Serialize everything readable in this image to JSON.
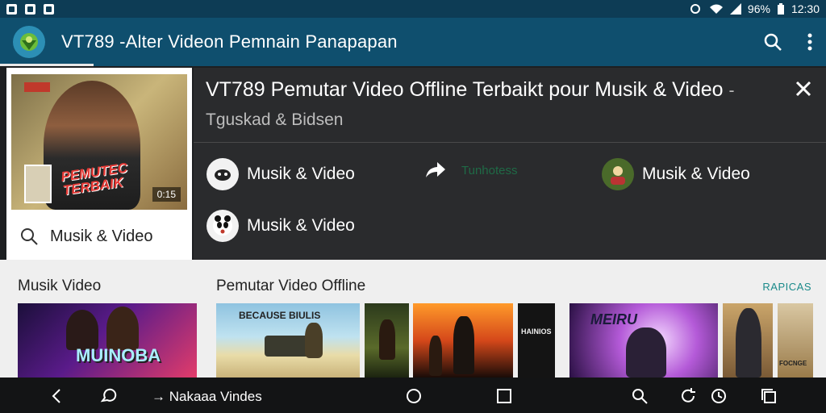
{
  "status": {
    "battery_pct": "96%",
    "time": "12:30"
  },
  "appbar": {
    "title": "VT789 -Alter Videon Pemnain Panapapan"
  },
  "left_card": {
    "overlay_text": "PEMUTEC TERBAIK",
    "duration": "0:15",
    "search_label": "Musik & Video"
  },
  "panel": {
    "title": "VT789 Pemutar Video Offline Terbaikt pour  Musik & Video",
    "subtitle": "- Tguskad & Bidsen",
    "options": [
      {
        "label": "Musik & Video",
        "icon": "cat-icon"
      },
      {
        "label": "Tunhotess",
        "icon": "share-icon"
      },
      {
        "label": "Musik & Video",
        "icon": "avatar-icon"
      },
      {
        "label": "Musik & Video",
        "icon": "panda-icon"
      }
    ]
  },
  "feed": {
    "section1": "Musik Video",
    "section2": "Pemutar Video Offline",
    "see_more": "RAPICAS",
    "cards": [
      {
        "caption": "MUINOBA"
      },
      {
        "caption": "BECAUSE BIULIS"
      },
      {
        "caption": ""
      },
      {
        "caption": ""
      },
      {
        "caption": "HAINIOS"
      },
      {
        "caption": "MEIRU"
      },
      {
        "caption": ""
      },
      {
        "caption": "FOCNGE"
      }
    ]
  },
  "navbar": {
    "label": "→ Nakaaa Vindes"
  },
  "colors": {
    "appbar": "#0f4f6e",
    "status": "#0d3c55",
    "panel": "#2a2b2d",
    "accent": "#1a8a8a"
  }
}
